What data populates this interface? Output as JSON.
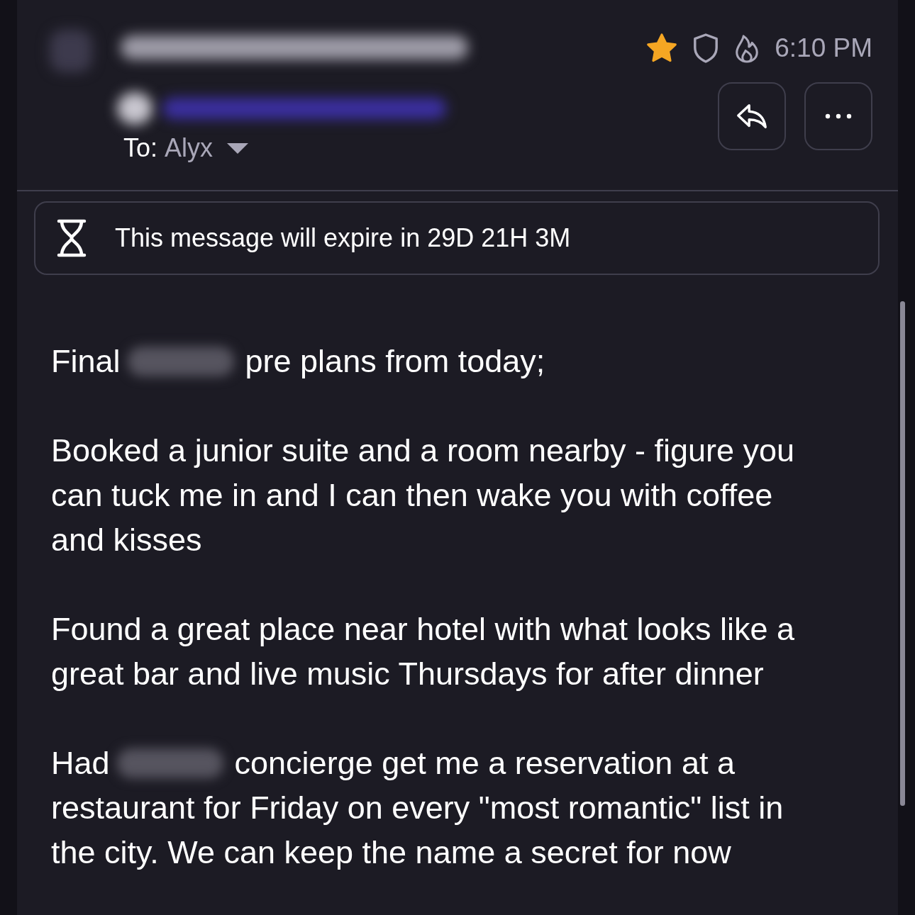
{
  "header": {
    "starred": true,
    "time": "6:10 PM",
    "to_label": "To:",
    "recipient": "Alyx"
  },
  "expiry": {
    "text": "This message will expire in 29D 21H 3M"
  },
  "body": [
    {
      "lines": [
        [
          {
            "kind": "text",
            "text": "Final"
          },
          {
            "kind": "redacted"
          },
          {
            "kind": "text",
            "text": "pre plans from today;"
          }
        ]
      ]
    },
    {
      "lines": [
        [
          {
            "kind": "text",
            "text": "Booked a junior suite and a room nearby - figure you"
          }
        ],
        [
          {
            "kind": "text",
            "text": "can tuck me in and I can then wake you with coffee"
          }
        ],
        [
          {
            "kind": "text",
            "text": "and kisses"
          }
        ]
      ]
    },
    {
      "lines": [
        [
          {
            "kind": "text",
            "text": "Found a great place near hotel with what looks like a"
          }
        ],
        [
          {
            "kind": "text",
            "text": "great bar and live music Thursdays for after dinner"
          }
        ]
      ]
    },
    {
      "lines": [
        [
          {
            "kind": "text",
            "text": "Had"
          },
          {
            "kind": "redacted"
          },
          {
            "kind": "text",
            "text": "concierge get me a reservation at a"
          }
        ],
        [
          {
            "kind": "text",
            "text": "restaurant for Friday on every \"most romantic\" list in"
          }
        ],
        [
          {
            "kind": "text",
            "text": "the city. We can keep the name a secret for now"
          }
        ]
      ]
    }
  ]
}
